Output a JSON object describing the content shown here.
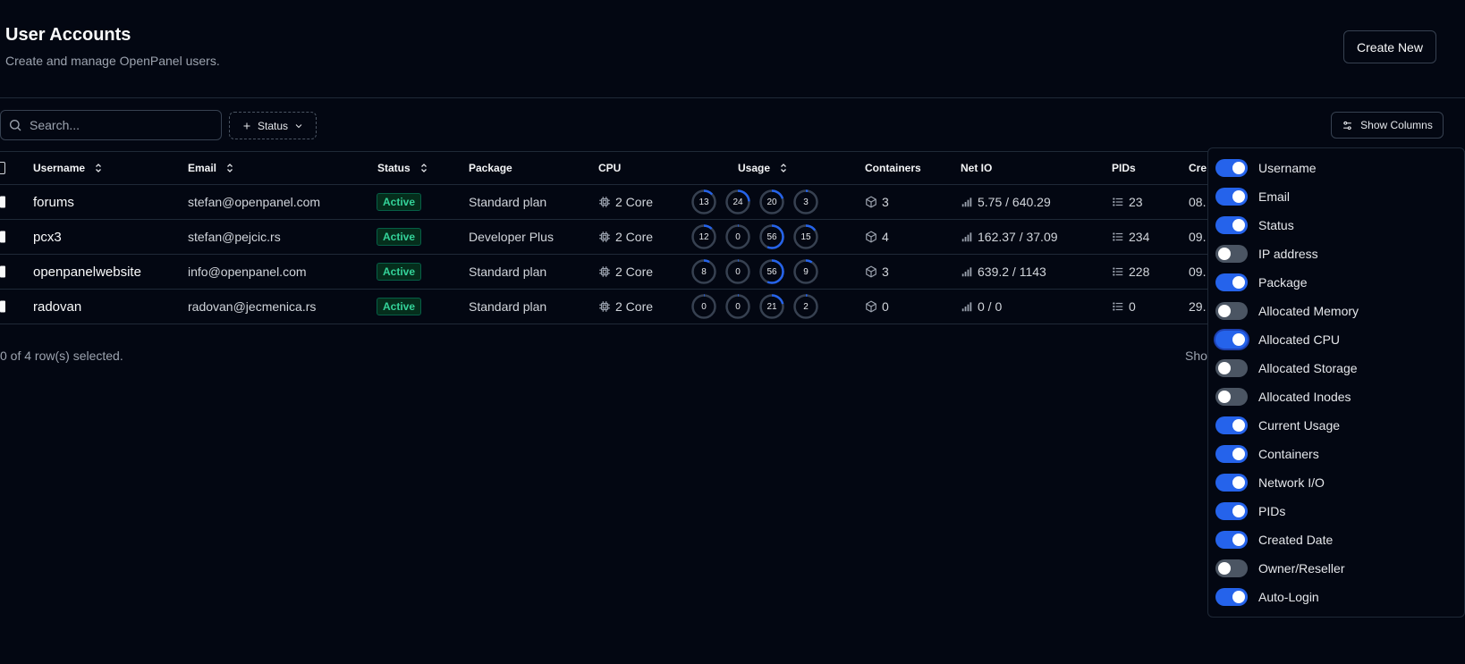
{
  "header": {
    "title": "User Accounts",
    "subtitle": "Create and manage OpenPanel users.",
    "create_button": "Create New"
  },
  "toolbar": {
    "search_placeholder": "Search...",
    "status_filter": "Status",
    "show_columns": "Show Columns"
  },
  "table": {
    "columns": {
      "username": "Username",
      "email": "Email",
      "status": "Status",
      "package": "Package",
      "cpu": "CPU",
      "usage": "Usage",
      "containers": "Containers",
      "net_io": "Net IO",
      "pids": "PIDs",
      "created": "Cre"
    },
    "rows": [
      {
        "username": "forums",
        "email": "stefan@openpanel.com",
        "status": "Active",
        "package": "Standard plan",
        "cpu": "2 Core",
        "usage": [
          13,
          24,
          20,
          3
        ],
        "containers": "3",
        "net_io": "5.75 / 640.29",
        "pids": "23",
        "created": "08."
      },
      {
        "username": "pcx3",
        "email": "stefan@pejcic.rs",
        "status": "Active",
        "package": "Developer Plus",
        "cpu": "2 Core",
        "usage": [
          12,
          0,
          56,
          15
        ],
        "containers": "4",
        "net_io": "162.37 / 37.09",
        "pids": "234",
        "created": "09."
      },
      {
        "username": "openpanelwebsite",
        "email": "info@openpanel.com",
        "status": "Active",
        "package": "Standard plan",
        "cpu": "2 Core",
        "usage": [
          8,
          0,
          56,
          9
        ],
        "containers": "3",
        "net_io": "639.2 / 1143",
        "pids": "228",
        "created": "09."
      },
      {
        "username": "radovan",
        "email": "radovan@jecmenica.rs",
        "status": "Active",
        "package": "Standard plan",
        "cpu": "2 Core",
        "usage": [
          0,
          0,
          21,
          2
        ],
        "containers": "0",
        "net_io": "0 / 0",
        "pids": "0",
        "created": "29."
      }
    ]
  },
  "footer": {
    "selection": "0 of 4 row(s) selected.",
    "right_partial": "Sho"
  },
  "column_menu": {
    "items": [
      {
        "label": "Username",
        "on": true
      },
      {
        "label": "Email",
        "on": true
      },
      {
        "label": "Status",
        "on": true
      },
      {
        "label": "IP address",
        "on": false
      },
      {
        "label": "Package",
        "on": true
      },
      {
        "label": "Allocated Memory",
        "on": false
      },
      {
        "label": "Allocated CPU",
        "on": true,
        "focused": true
      },
      {
        "label": "Allocated Storage",
        "on": false
      },
      {
        "label": "Allocated Inodes",
        "on": false
      },
      {
        "label": "Current Usage",
        "on": true
      },
      {
        "label": "Containers",
        "on": true
      },
      {
        "label": "Network I/O",
        "on": true
      },
      {
        "label": "PIDs",
        "on": true
      },
      {
        "label": "Created Date",
        "on": true
      },
      {
        "label": "Owner/Reseller",
        "on": false
      },
      {
        "label": "Auto-Login",
        "on": true
      }
    ]
  },
  "colors": {
    "background": "#030712",
    "accent": "#2563eb",
    "active_badge": "#34d399",
    "border": "#1f2937"
  }
}
